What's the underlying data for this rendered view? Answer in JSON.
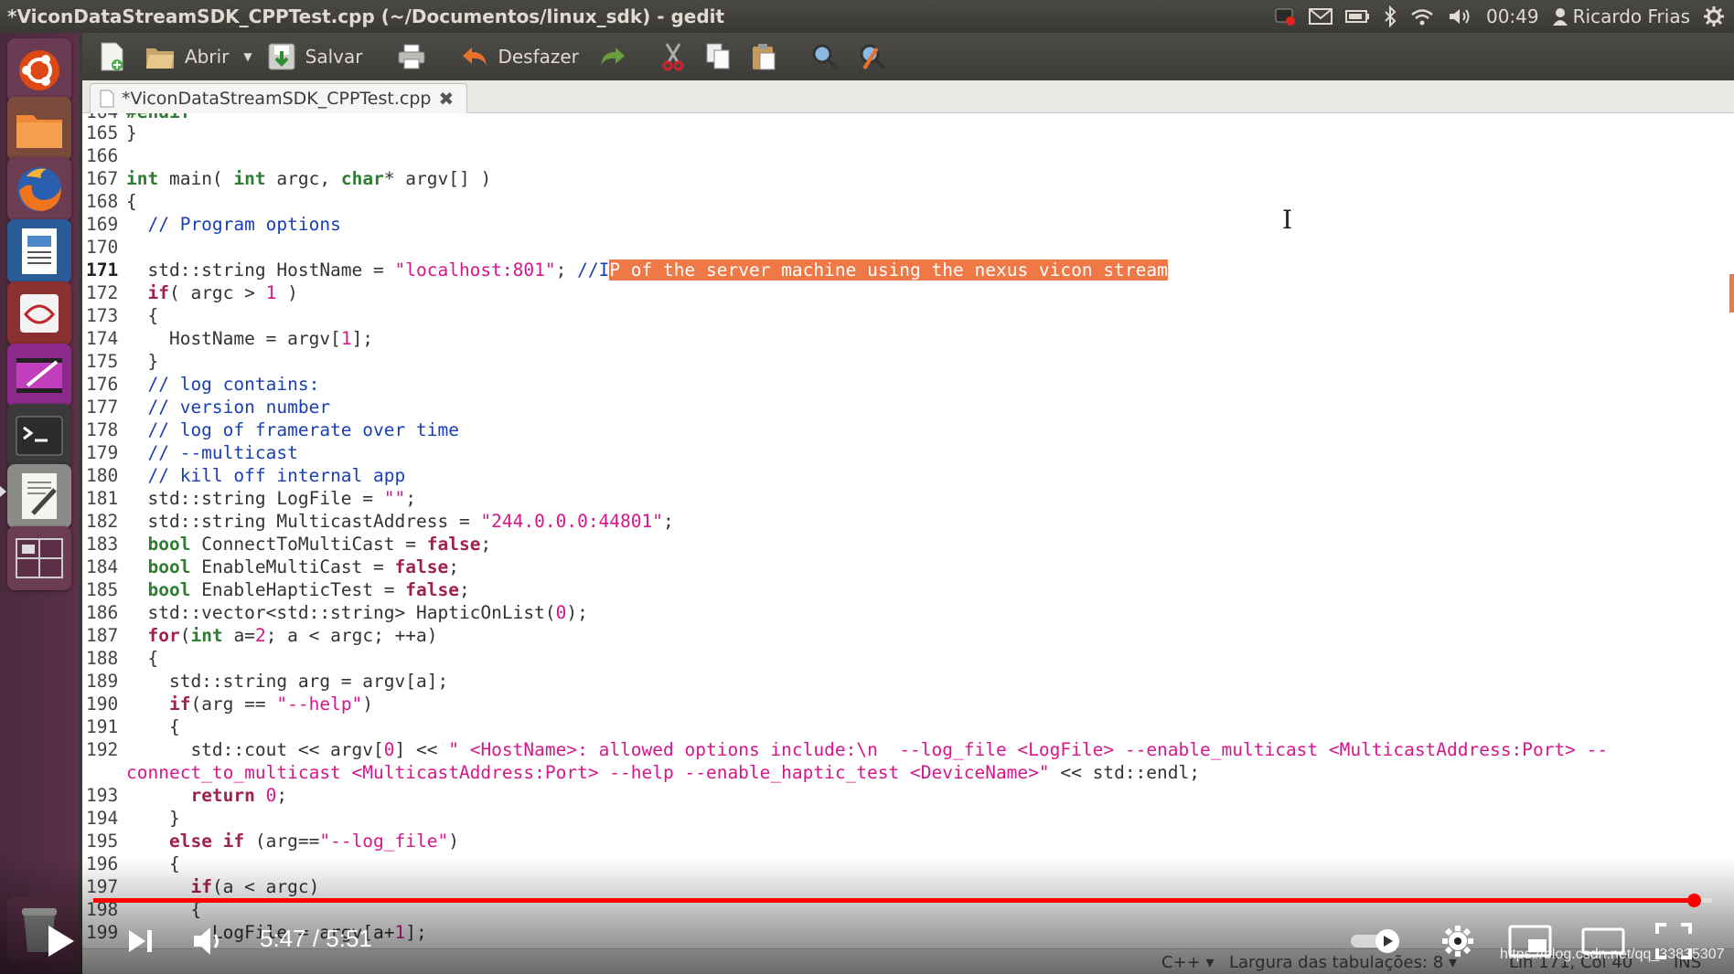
{
  "window": {
    "title": "*ViconDataStreamSDK_CPPTest.cpp (~/Documentos/linux_sdk) - gedit"
  },
  "panel": {
    "time": "00:49",
    "user": "Ricardo Frias",
    "icons": [
      "record-icon",
      "mail-icon",
      "battery-icon",
      "bluetooth-icon",
      "wifi-icon",
      "volume-icon",
      "user-icon",
      "power-gear-icon"
    ]
  },
  "launcher": {
    "items": [
      "ubuntu-dash",
      "files",
      "firefox",
      "libreoffice-writer",
      "evince",
      "video-editor",
      "terminal",
      "text-editor",
      "workspace-switcher",
      "trash"
    ]
  },
  "toolbar": {
    "open_label": "Abrir",
    "save_label": "Salvar",
    "undo_label": "Desfazer"
  },
  "tab": {
    "label": "*ViconDataStreamSDK_CPPTest.cpp"
  },
  "editor": {
    "accent_selection": "#f07746",
    "current_line": 171
  },
  "status": {
    "language": "C++ ▾",
    "tab_width": "Largura das tabulações: 8 ▾",
    "position": "Lin 171, Col 40",
    "mode": "INS"
  },
  "video": {
    "current_time": "5:47",
    "separator": " / ",
    "duration": "5:51",
    "progress_fraction": 0.9886,
    "watermark": "https://blog.csdn.net/qq_33835307"
  }
}
